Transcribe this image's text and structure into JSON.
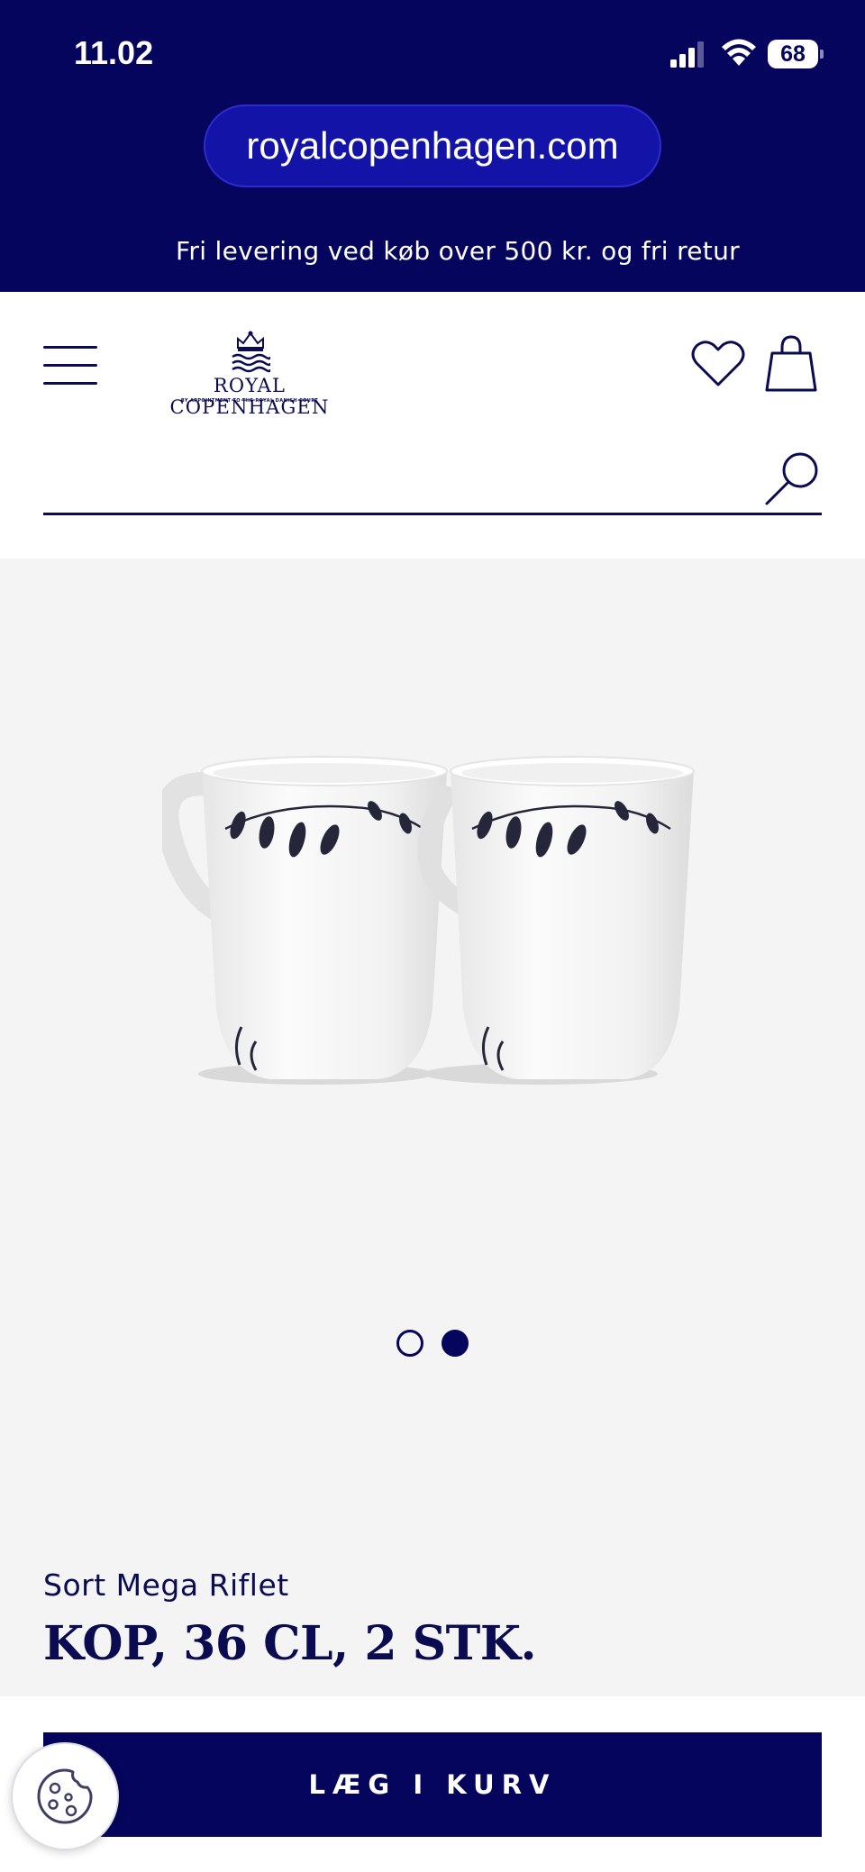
{
  "status_bar": {
    "time": "11.02",
    "battery": "68"
  },
  "browser": {
    "url": "royalcopenhagen.com"
  },
  "promo": {
    "text": "Fri levering ved køb over 500 kr. og fri retur"
  },
  "brand": {
    "name": "ROYAL COPENHAGEN",
    "tagline": "BY APPOINTMENT TO THE ROYAL DANISH COURT"
  },
  "search": {
    "value": "",
    "placeholder": ""
  },
  "gallery": {
    "total_images": 2,
    "active_index": 2
  },
  "product": {
    "collection": "Sort Mega Riflet",
    "title": "KOP, 36 CL, 2 STK.",
    "add_to_cart_label": "LÆG I KURV"
  },
  "colors": {
    "brand_navy": "#05055e",
    "url_pill": "#1313a8",
    "gallery_bg": "#f4f4f4"
  },
  "icons": [
    "signal-icon",
    "wifi-icon",
    "battery-icon",
    "menu-icon",
    "crown-logo-icon",
    "heart-icon",
    "bag-icon",
    "search-icon",
    "cookie-icon"
  ]
}
